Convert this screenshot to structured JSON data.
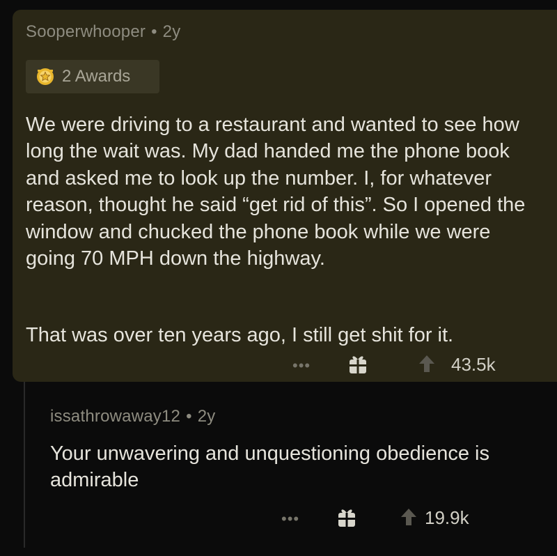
{
  "top_comment": {
    "author": "Sooperwhooper",
    "separator": "•",
    "age": "2y",
    "awards_label": "2 Awards",
    "award_icon": "award-icon",
    "paragraph_1": "We were driving to a restaurant and wanted to see how long the wait was. My dad handed me the phone book and asked me to look up the number. I, for whatever reason, thought he said “get rid of this”. So I opened the window and chucked the phone book while we were going 70 MPH down the highway.",
    "paragraph_2": "That was over ten years ago, I still get shit for it.",
    "more_label": "•••",
    "score": "43.5k"
  },
  "reply": {
    "author": "issathrowaway12",
    "separator": "•",
    "age": "2y",
    "text": "Your unwavering and unquestioning obedience is admirable",
    "more_label": "•••",
    "score": "19.9k"
  },
  "colors": {
    "highlight_background": "#2a2716",
    "page_background": "#0b0b0b",
    "body_text": "#e6e4dc",
    "meta_text": "#8e8c80",
    "award_gold": "#e8b62c"
  }
}
